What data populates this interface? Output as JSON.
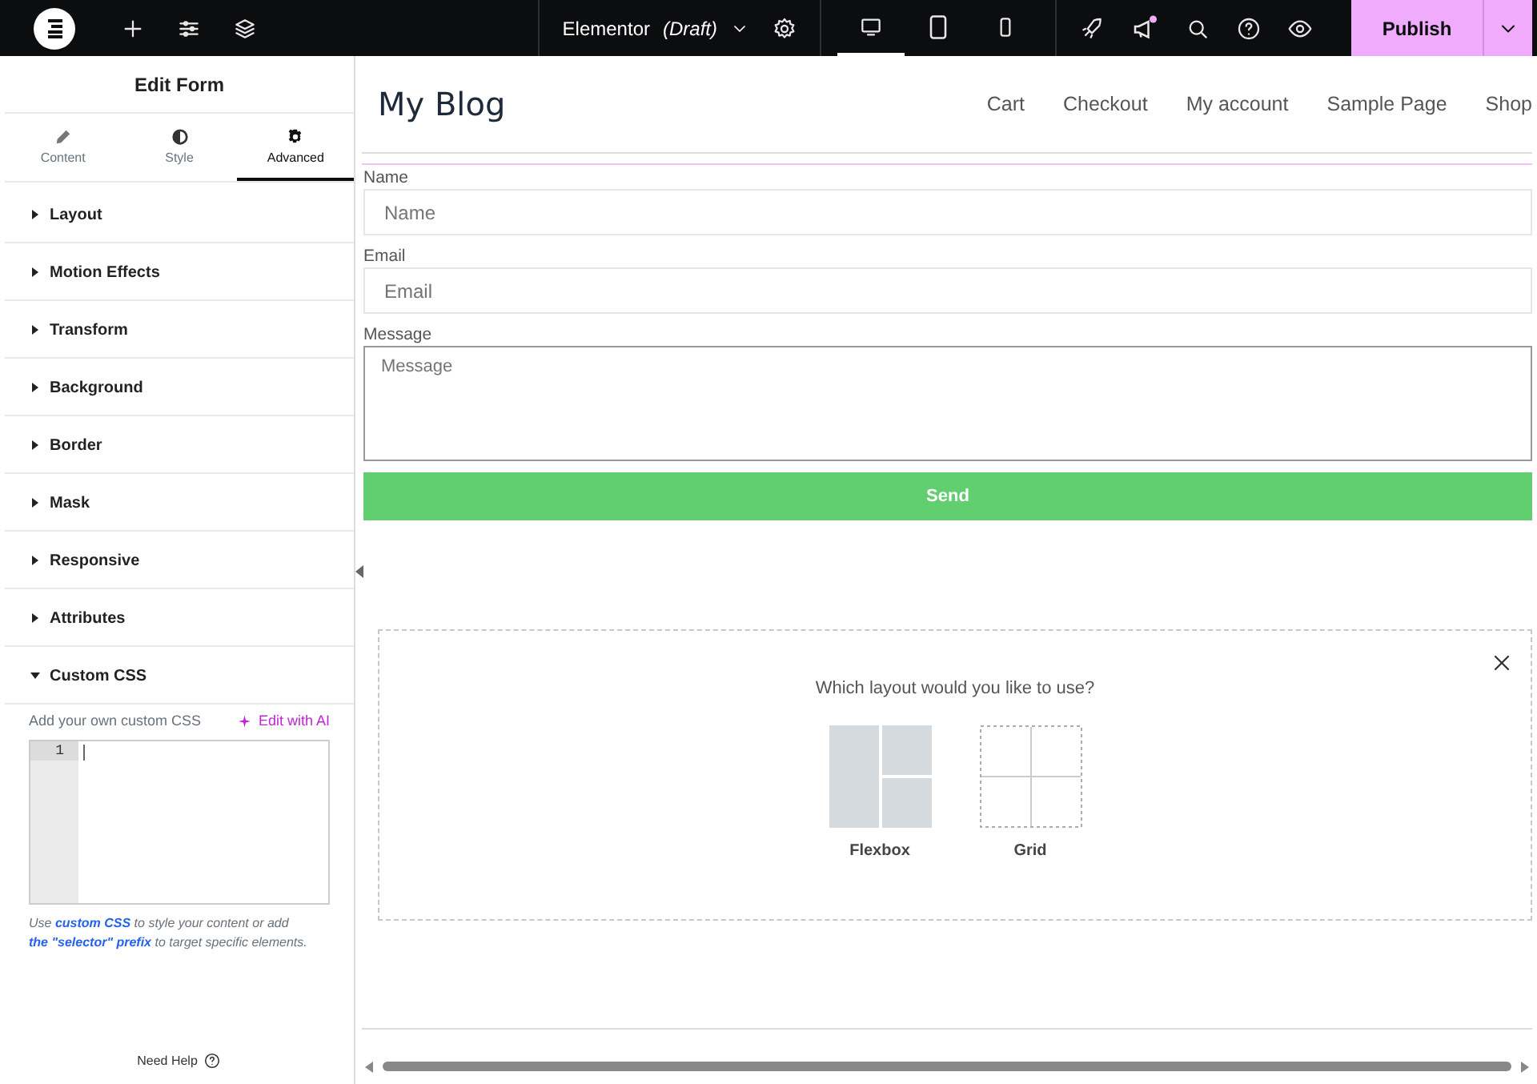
{
  "topbar": {
    "document_title": "Elementor *(Draft)*",
    "devices": [
      {
        "kind": "desktop",
        "selected": true
      },
      {
        "kind": "tablet",
        "selected": false
      },
      {
        "kind": "mobile",
        "selected": false
      }
    ],
    "publish": "Publish"
  },
  "panel": {
    "title": "Edit Form",
    "tabs": [
      {
        "label": "Content",
        "kind": "pencil",
        "selected": false
      },
      {
        "label": "Style",
        "kind": "contrast",
        "selected": false
      },
      {
        "label": "Advanced",
        "kind": "gear",
        "selected": true
      }
    ],
    "sections": [
      {
        "label": "Layout",
        "expanded": false
      },
      {
        "label": "Motion Effects",
        "expanded": false
      },
      {
        "label": "Transform",
        "expanded": false
      },
      {
        "label": "Background",
        "expanded": false
      },
      {
        "label": "Border",
        "expanded": false
      },
      {
        "label": "Mask",
        "expanded": false
      },
      {
        "label": "Responsive",
        "expanded": false
      },
      {
        "label": "Attributes",
        "expanded": false
      },
      {
        "label": "Custom CSS",
        "expanded": true
      }
    ],
    "custom_css": {
      "label": "Add your own custom CSS",
      "ai_link": "Edit with AI",
      "line_number": "1",
      "help": [
        {
          "text": "Use ",
          "kind": "text"
        },
        {
          "text": "custom CSS",
          "kind": "link"
        },
        {
          "text": " to style your content or add ",
          "kind": "text"
        },
        {
          "text": "the \"selector\" prefix",
          "kind": "link"
        },
        {
          "text": " to target specific elements.",
          "kind": "text"
        }
      ]
    },
    "need_help": "Need Help"
  },
  "site": {
    "title": "My Blog",
    "nav": [
      "Cart",
      "Checkout",
      "My account",
      "Sample Page",
      "Shop"
    ]
  },
  "form": {
    "fields": [
      {
        "label": "Name",
        "placeholder": "Name",
        "kind": "input"
      },
      {
        "label": "Email",
        "placeholder": "Email",
        "kind": "input"
      },
      {
        "label": "Message",
        "placeholder": "Message",
        "kind": "textarea"
      }
    ],
    "button": "Send"
  },
  "layout_picker": {
    "question": "Which layout would you like to use?",
    "options": [
      {
        "label": "Flexbox",
        "kind": "flexbox"
      },
      {
        "label": "Grid",
        "kind": "grid"
      }
    ]
  }
}
